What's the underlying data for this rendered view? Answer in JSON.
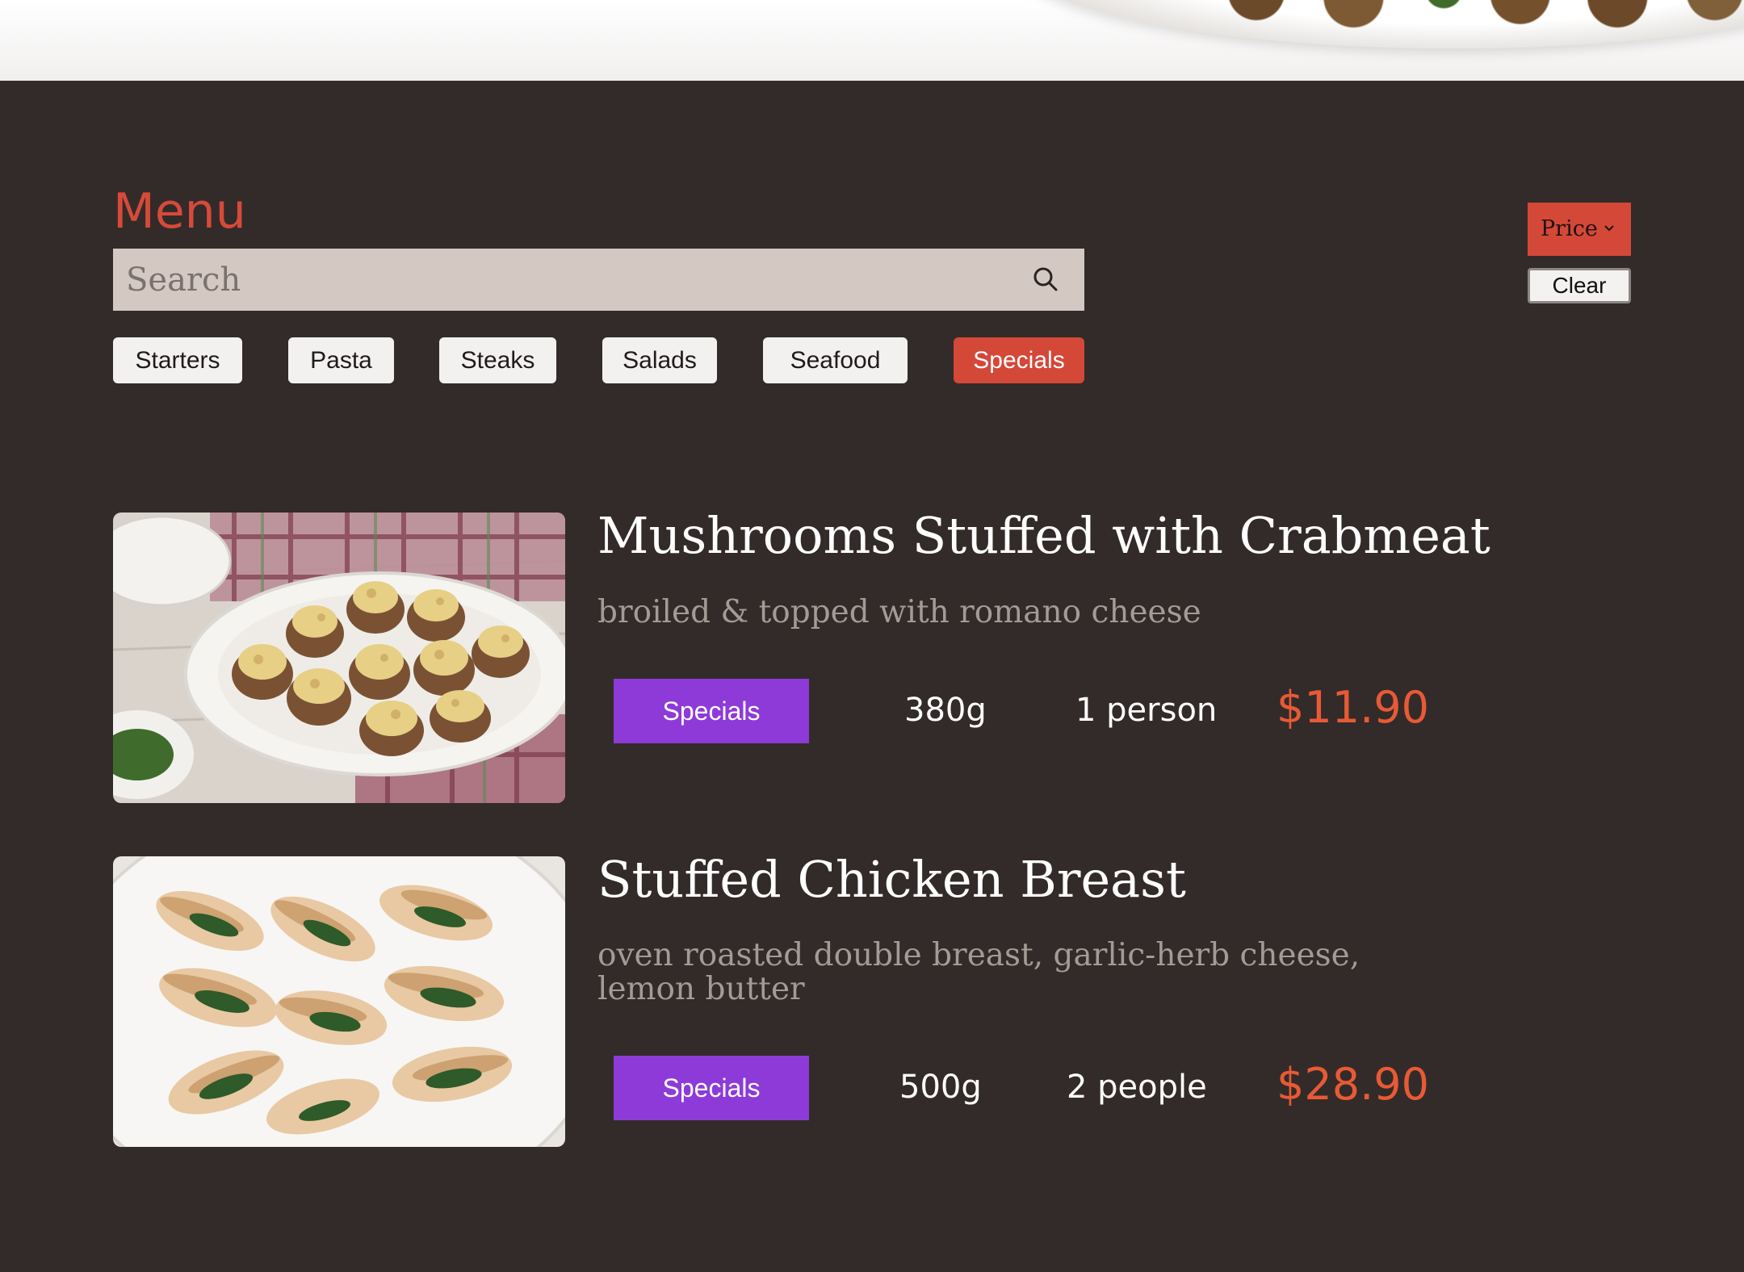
{
  "page": {
    "title": "Menu"
  },
  "search": {
    "placeholder": "Search",
    "value": ""
  },
  "categories": [
    {
      "label": "Starters",
      "active": false
    },
    {
      "label": "Pasta",
      "active": false
    },
    {
      "label": "Steaks",
      "active": false
    },
    {
      "label": "Salads",
      "active": false
    },
    {
      "label": "Seafood",
      "active": false
    },
    {
      "label": "Specials",
      "active": true
    }
  ],
  "sort": {
    "price_label": "Price",
    "clear_label": "Clear"
  },
  "items": [
    {
      "name": "Mushrooms Stuffed with Crabmeat",
      "description": "broiled & topped with romano cheese",
      "tag": "Specials",
      "weight": "380g",
      "serves": "1 person",
      "price": "$11.90"
    },
    {
      "name": "Stuffed Chicken Breast",
      "description": "oven roasted double breast, garlic-herb cheese, lemon butter",
      "tag": "Specials",
      "weight": "500g",
      "serves": "2 people",
      "price": "$28.90"
    }
  ],
  "colors": {
    "background": "#332b29",
    "accent": "#d44838",
    "tag": "#8e3ad8",
    "price": "#e85a35"
  }
}
